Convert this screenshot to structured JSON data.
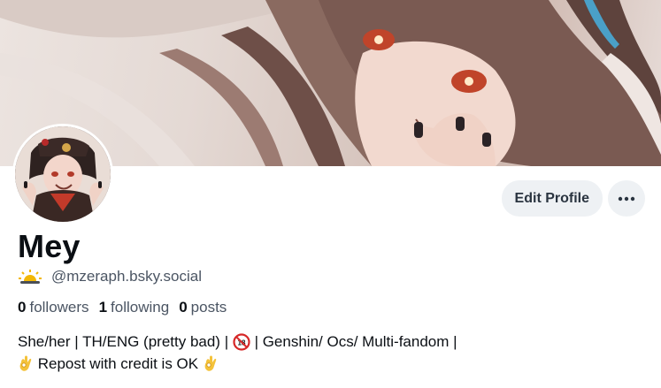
{
  "profile": {
    "display_name": "Mey",
    "handle": "@mzeraph.bsky.social",
    "handle_emoji": "sun-behind-cloud-icon"
  },
  "stats": {
    "followers_count": "0",
    "followers_label": "followers",
    "following_count": "1",
    "following_label": "following",
    "posts_count": "0",
    "posts_label": "posts"
  },
  "actions": {
    "edit_label": "Edit Profile",
    "more_icon": "more-horizontal-icon"
  },
  "bio": {
    "line1_a": "She/her | TH/ENG (pretty bad) | ",
    "line1_icon": "no-under-18-icon",
    "line1_b": " | Genshin/ Ocs/ Multi-fandom |",
    "line2_icon_left": "ok-hand-icon",
    "line2_text": " Repost with credit is OK ",
    "line2_icon_right": "ok-hand-icon"
  },
  "colors": {
    "button_bg": "#eef1f4",
    "text_primary": "#0b0f14",
    "text_secondary": "#4b5563",
    "no18_red": "#d62828"
  }
}
